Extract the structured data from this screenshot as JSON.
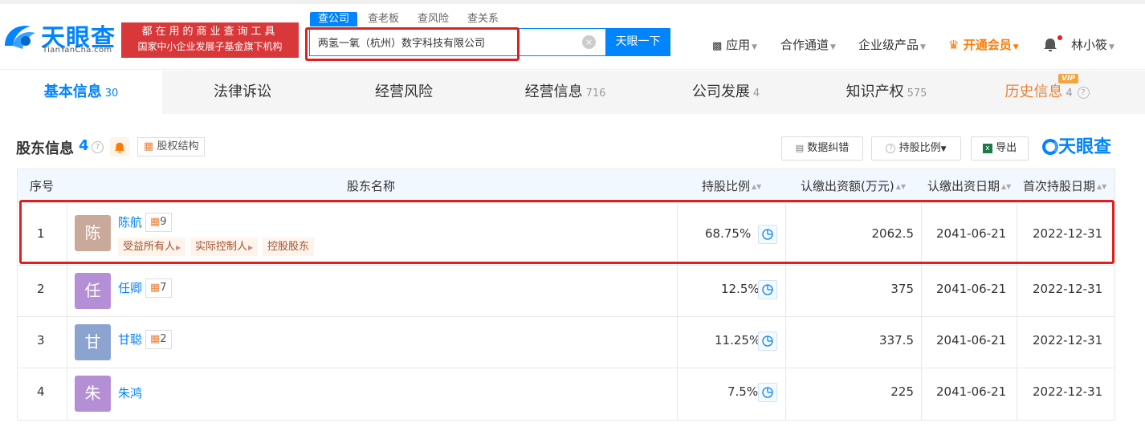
{
  "header": {
    "logo_text": "天眼查",
    "logo_sub": "TianYanCha.com",
    "slogan_line1": "都在用的商业查询工具",
    "slogan_line2": "国家中小企业发展子基金旗下机构",
    "search_tabs": [
      "查公司",
      "查老板",
      "查风险",
      "查关系"
    ],
    "search_value": "两氢一氧（杭州）数字科技有限公司",
    "search_clear": "×",
    "search_button": "天眼一下",
    "nav": {
      "apps": "应用",
      "partner": "合作通道",
      "enterprise": "企业级产品",
      "vip": "开通会员",
      "user": "林小筱"
    }
  },
  "tabs": [
    {
      "label": "基本信息",
      "count": "30"
    },
    {
      "label": "法律诉讼",
      "count": ""
    },
    {
      "label": "经营风险",
      "count": ""
    },
    {
      "label": "经营信息",
      "count": "716"
    },
    {
      "label": "公司发展",
      "count": "4"
    },
    {
      "label": "知识产权",
      "count": "575"
    },
    {
      "label": "历史信息",
      "count": "4"
    }
  ],
  "vip_badge": "VIP",
  "section": {
    "title": "股东信息",
    "count": "4",
    "help": "?",
    "equity_structure": "股权结构",
    "data_correction": "数据纠错",
    "ratio_filter": "持股比例",
    "export": "导出",
    "brand": "天眼查"
  },
  "table": {
    "headers": {
      "index": "序号",
      "name": "股东名称",
      "ratio": "持股比例",
      "amount": "认缴出资额(万元)",
      "date": "认缴出资日期",
      "first_date": "首次持股日期"
    },
    "rows": [
      {
        "index": "1",
        "avatar": "陈",
        "avatar_color": "#c9a99a",
        "name": "陈航",
        "related": "9",
        "ratio": "68.75%",
        "amount": "2062.5",
        "date": "2041-06-21",
        "first_date": "2022-12-31",
        "tags": [
          "受益所有人",
          "实际控制人",
          "控股股东"
        ]
      },
      {
        "index": "2",
        "avatar": "任",
        "avatar_color": "#b58fd6",
        "name": "任卿",
        "related": "7",
        "ratio": "12.5%",
        "amount": "375",
        "date": "2041-06-21",
        "first_date": "2022-12-31",
        "tags": []
      },
      {
        "index": "3",
        "avatar": "甘",
        "avatar_color": "#8aa3cf",
        "name": "甘聪",
        "related": "2",
        "ratio": "11.25%",
        "amount": "337.5",
        "date": "2041-06-21",
        "first_date": "2022-12-31",
        "tags": []
      },
      {
        "index": "4",
        "avatar": "朱",
        "avatar_color": "#b58fd6",
        "name": "朱鸿",
        "related": "",
        "ratio": "7.5%",
        "amount": "225",
        "date": "2041-06-21",
        "first_date": "2022-12-31",
        "tags": []
      }
    ]
  },
  "colors": {
    "brand_blue": "#0084ff",
    "highlight_red": "#e02020",
    "vip_orange": "#ff7a00"
  }
}
